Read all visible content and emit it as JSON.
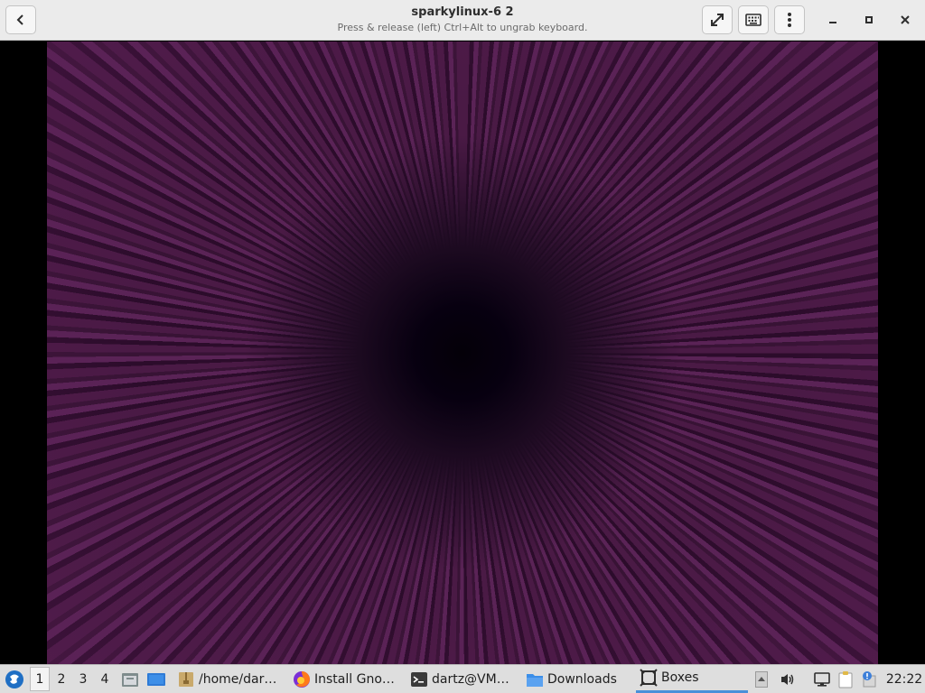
{
  "window": {
    "title": "sparkylinux-6 2",
    "subtitle": "Press & release (left) Ctrl+Alt to ungrab keyboard."
  },
  "taskbar": {
    "workspaces": [
      "1",
      "2",
      "3",
      "4"
    ],
    "active_workspace": "1",
    "tasks": [
      {
        "label": "/home/dar…",
        "icon": "archive-folder-icon"
      },
      {
        "label": "Install Gno…",
        "icon": "firefox-icon"
      },
      {
        "label": "dartz@VM…",
        "icon": "terminal-icon"
      },
      {
        "label": "Downloads",
        "icon": "folder-icon"
      },
      {
        "label": "Boxes",
        "icon": "boxes-icon",
        "active": true
      }
    ],
    "clock": "22:22"
  },
  "colors": {
    "header_bg": "#ebebeb",
    "taskbar_bg": "#dedede",
    "accent": "#4a90d9",
    "wallpaper": "#4a1a45"
  }
}
